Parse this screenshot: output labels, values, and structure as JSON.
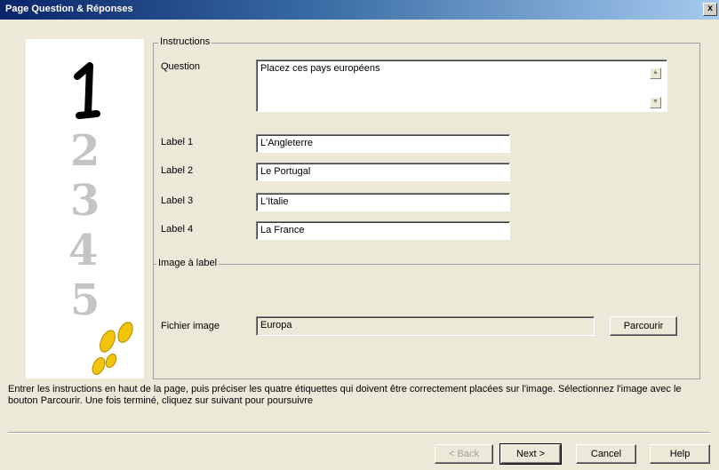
{
  "window": {
    "title": "Page Question & Réponses",
    "close_label": "x"
  },
  "side_panel": {
    "numbers": [
      "1",
      "2",
      "3",
      "4",
      "5"
    ],
    "icon": "footprints-icon"
  },
  "instructions_group": {
    "legend": "Instructions",
    "question_label": "Question",
    "question_value": "Placez ces pays européens",
    "labels": [
      {
        "label": "Label 1",
        "value": "L'Angleterre"
      },
      {
        "label": "Label 2",
        "value": "Le Portugal"
      },
      {
        "label": "Label 3",
        "value": "L'Italie"
      },
      {
        "label": "Label 4",
        "value": "La France"
      }
    ]
  },
  "image_group": {
    "legend": "Image à label",
    "file_label": "Fichier image",
    "file_value": "Europa",
    "browse_button": "Parcourir"
  },
  "help_text": "Entrer les instructions en haut de la page, puis préciser les quatre étiquettes qui doivent être correctement placées sur l'image. Sélectionnez l'image avec le bouton Parcourir. Une fois terminé, cliquez sur suivant pour poursuivre",
  "buttons": {
    "back": "< Back",
    "next": "Next >",
    "cancel": "Cancel",
    "help": "Help"
  },
  "colors": {
    "footprint": "#f2c40a",
    "active_number": "#000000",
    "inactive_number": "#b8b8b8"
  }
}
